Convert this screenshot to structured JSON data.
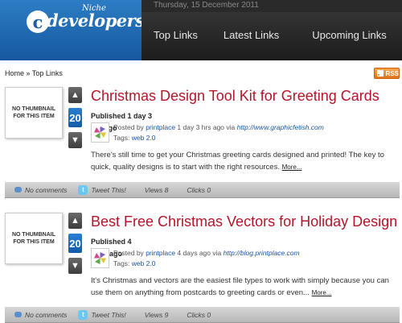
{
  "header": {
    "logo_letter": "c",
    "logo_word": "developers",
    "logo_niche": "Niche",
    "date": "Thursday, 15 December 2011",
    "nav": [
      "Top Links",
      "Latest Links",
      "Upcoming Links"
    ]
  },
  "breadcrumb": {
    "home": "Home",
    "sep": "»",
    "current": "Top Links"
  },
  "rss": {
    "label": "RSS"
  },
  "posts": [
    {
      "thumbnail_text": "NO THUMBNAIL FOR THIS ITEM",
      "votes": "20",
      "title": "Christmas Design Tool Kit for Greeting Cards",
      "published_label": "Published 1 day 3",
      "published_tail": "hrs ago",
      "meta_posted_by": "Posted by",
      "author": "printplace",
      "time": "1 day 3 hrs ago",
      "via": "via",
      "url": "http://www.graphicfetish.com",
      "tags_label": "Tags:",
      "tags": "web 2.0",
      "excerpt": "There's still time to get your Christmas greeting cards designed and printed! The key to quick, quality designs is to start with the right resources.",
      "more": "More...",
      "comments": "No comments",
      "tweet": "Tweet This!",
      "views": "Views 8",
      "clicks": "Clicks 0"
    },
    {
      "thumbnail_text": "NO THUMBNAIL FOR THIS ITEM",
      "votes": "20",
      "title": "Best Free Christmas Vectors for Holiday Design",
      "published_label": "Published 4",
      "published_tail": "days ago",
      "meta_posted_by": "Posted by",
      "author": "printplace",
      "time": "4 days ago",
      "via": "via",
      "url": "http://blog.printplace.com",
      "tags_label": "Tags:",
      "tags": "web 2.0",
      "excerpt": "It's Christmas and vectors are the easiest file types to work with simply because you can use them on anything from postcards to greeting cards or even...",
      "more": "More...",
      "comments": "No comments",
      "tweet": "Tweet This!",
      "views": "Views 9",
      "clicks": "Clicks 0"
    }
  ]
}
